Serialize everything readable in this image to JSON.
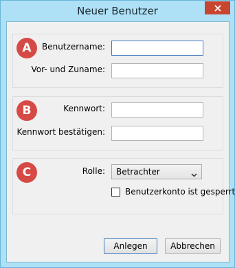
{
  "window": {
    "title": "Neuer Benutzer"
  },
  "badges": {
    "a": "A",
    "b": "B",
    "c": "C"
  },
  "account": {
    "username_label": "Benutzername:",
    "username_value": "",
    "fullname_label": "Vor- und Zuname:",
    "fullname_value": ""
  },
  "password": {
    "password_label": "Kennwort:",
    "password_value": "",
    "confirm_label": "Kennwort bestätigen:",
    "confirm_value": ""
  },
  "role": {
    "role_label": "Rolle:",
    "role_selected": "Betrachter",
    "locked_label": "Benutzerkonto ist gesperrt",
    "locked_checked": false
  },
  "buttons": {
    "create": "Anlegen",
    "cancel": "Abbrechen"
  },
  "colors": {
    "frame": "#aee0f6",
    "badge": "#d64a45",
    "close": "#c8452f",
    "focus": "#3d7bc0"
  },
  "icons": {
    "close": "close-icon",
    "dropdown": "chevron-down-icon"
  }
}
